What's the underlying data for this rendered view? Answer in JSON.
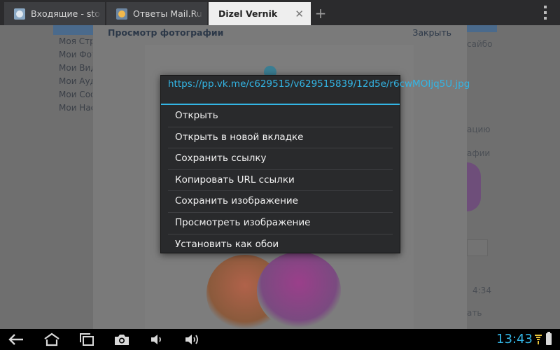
{
  "tabs": [
    {
      "title": "Входящие - stodv",
      "active": false
    },
    {
      "title": "Ответы Mail.Ru: Н",
      "active": false
    },
    {
      "title": "Dizel Vernik",
      "active": true
    }
  ],
  "new_tab_label": "+",
  "page": {
    "left_links": [
      "Моя Стр",
      "Мои Фот",
      "Мои Вид",
      "Мои Ауд",
      "Мои Соо",
      "Мои Нас"
    ],
    "right_texts": [
      "сайбо",
      "ацию",
      "афии",
      "4:34",
      "ать"
    ]
  },
  "viewer": {
    "title": "Просмотр фотографии",
    "close_label": "Закрыть"
  },
  "context_menu": {
    "url": "https://pp.vk.me/c629515/v629515839/12d5e/r6cwMOIjq5U.jpg",
    "items": [
      "Открыть",
      "Открыть в новой вкладке",
      "Сохранить ссылку",
      "Копировать URL ссылки",
      "Сохранить изображение",
      "Просмотреть изображение",
      "Установить как обои"
    ]
  },
  "status_bar": {
    "time": "13:43"
  },
  "colors": {
    "accent": "#33b5e5",
    "menu_background": "#292a2c",
    "tab_active": "#eeeeee",
    "tab_inactive": "#3d3e41"
  }
}
